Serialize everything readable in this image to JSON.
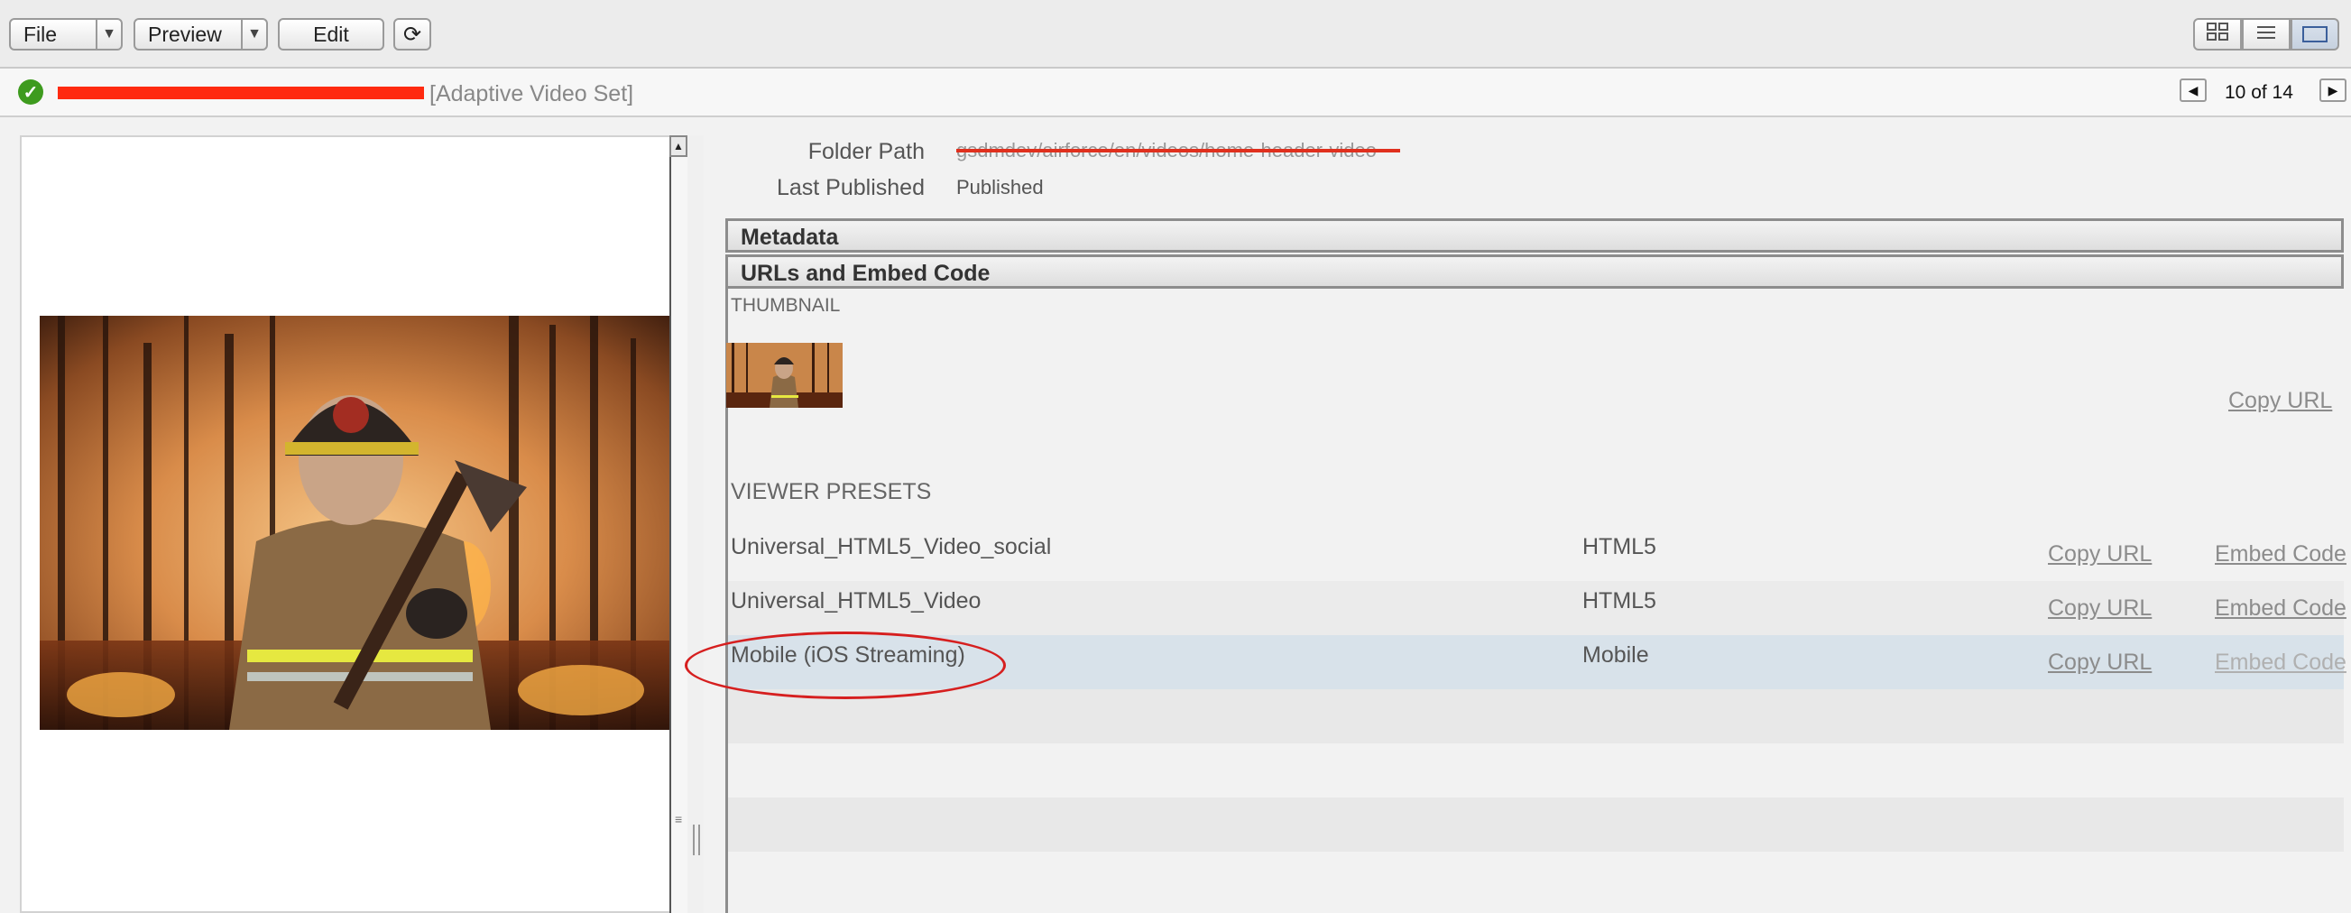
{
  "toolbar": {
    "file_label": "File",
    "preview_label": "Preview",
    "edit_label": "Edit",
    "refresh_icon": "refresh-icon",
    "view_modes": [
      "grid-view-icon",
      "list-view-icon",
      "detail-view-icon"
    ],
    "active_view": "detail"
  },
  "asset": {
    "name": "",
    "type_label": "[Adaptive Video Set]",
    "status_icon": "check-circle-icon",
    "position": "10 of 14"
  },
  "details": {
    "folder_path_label": "Folder Path",
    "folder_path_value": "gsdmdev/airforce/en/videos/home-header-video",
    "last_published_label": "Last Published",
    "last_published_value": "Published"
  },
  "sections": {
    "metadata": "Metadata",
    "urls_embed": "URLs and Embed Code",
    "thumbnail": "THUMBNAIL",
    "viewer_presets": "VIEWER PRESETS"
  },
  "thumbnail": {
    "copy_url": "Copy URL"
  },
  "viewer_presets": [
    {
      "name": "Universal_HTML5_Video_social",
      "type": "HTML5",
      "copy_url": "Copy URL",
      "embed_code": "Embed Code",
      "selected": false
    },
    {
      "name": "Universal_HTML5_Video",
      "type": "HTML5",
      "copy_url": "Copy URL",
      "embed_code": "Embed Code",
      "selected": false
    },
    {
      "name": "Mobile (iOS Streaming)",
      "type": "Mobile",
      "copy_url": "Copy URL",
      "embed_code": "Embed Code",
      "selected": true
    }
  ],
  "colors": {
    "accent_selected_row": "#d8e2ea",
    "status_ok": "#3e9b1e",
    "annotation_red": "#d61f1f",
    "redaction_red": "#ff2a10"
  }
}
